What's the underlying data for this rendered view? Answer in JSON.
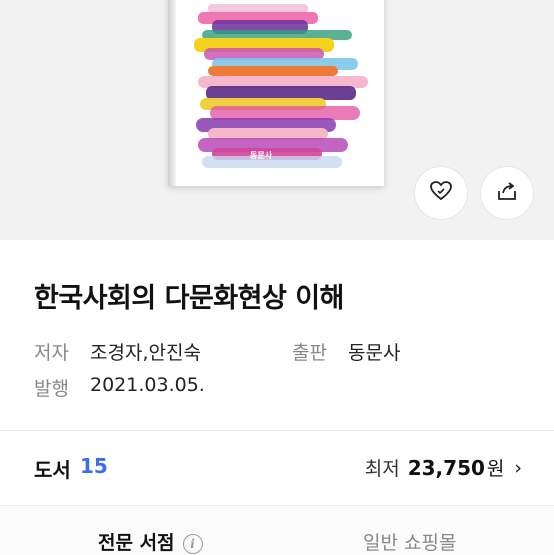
{
  "book": {
    "title": "한국사회의 다문화현상 이해",
    "author_label": "저자",
    "author": "조경자,안진숙",
    "publisher_label": "출판",
    "publisher": "동문사",
    "published_label": "발행",
    "published_date": "2021.03.05.",
    "cover_publisher_mark": "동문사"
  },
  "actions": {
    "like_icon": "heart-icon",
    "share_icon": "share-icon"
  },
  "availability": {
    "books_label": "도서",
    "books_count": "15",
    "lowest_label": "최저",
    "lowest_price": "23,750",
    "price_unit": "원",
    "chevron": "›"
  },
  "tabs": {
    "specialty": "전문 서점",
    "general": "일반 쇼핑몰"
  },
  "colors": {
    "accent": "#3b6ee8"
  }
}
